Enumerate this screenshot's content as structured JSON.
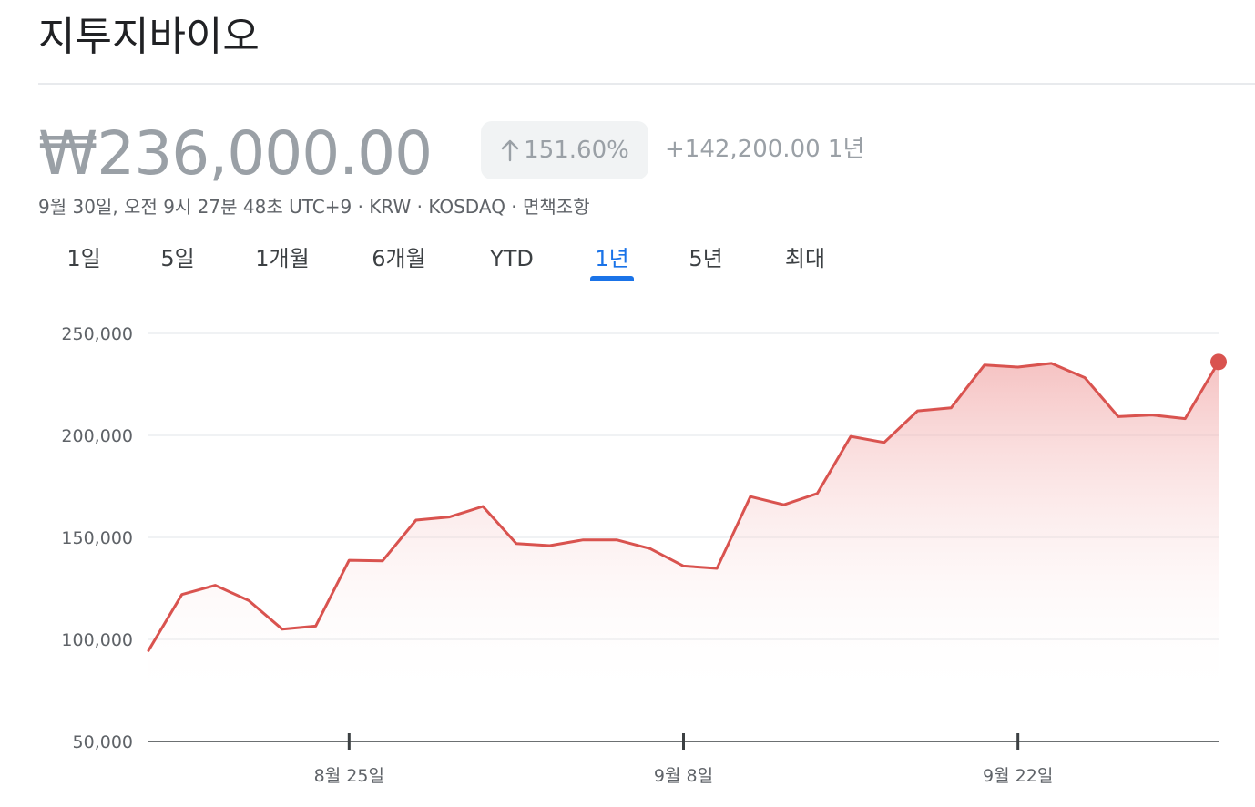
{
  "header": {
    "title": "지투지바이오"
  },
  "quote": {
    "price": "₩236,000.00",
    "change_percent": "151.60%",
    "change_abs": "+142,200.00 1년",
    "meta": "9월 30일, 오전 9시 27분 48초 UTC+9 · KRW · KOSDAQ · 면책조항"
  },
  "tabs": [
    {
      "label": "1일",
      "active": false
    },
    {
      "label": "5일",
      "active": false
    },
    {
      "label": "1개월",
      "active": false
    },
    {
      "label": "6개월",
      "active": false
    },
    {
      "label": "YTD",
      "active": false
    },
    {
      "label": "1년",
      "active": true
    },
    {
      "label": "5년",
      "active": false
    },
    {
      "label": "최대",
      "active": false
    }
  ],
  "colors": {
    "line": "#d9534f",
    "area_top": "#ef9a9a",
    "tab_active": "#1a73e8"
  },
  "chart_data": {
    "type": "area",
    "title": "",
    "xlabel": "",
    "ylabel": "",
    "ylim": [
      50000,
      250000
    ],
    "yticks": [
      250000,
      200000,
      150000,
      100000,
      50000
    ],
    "ytick_labels": [
      "250,000",
      "200,000",
      "150,000",
      "100,000",
      "50,000"
    ],
    "xticks": [
      {
        "index": 6,
        "label": "8월 25일"
      },
      {
        "index": 16,
        "label": "9월 8일"
      },
      {
        "index": 26,
        "label": "9월 22일"
      }
    ],
    "grid": true,
    "series": [
      {
        "values": [
          94500,
          122000,
          126500,
          119000,
          105000,
          106500,
          138800,
          138500,
          158500,
          160000,
          165200,
          147000,
          146000,
          148800,
          148800,
          144500,
          136000,
          134800,
          170000,
          166000,
          171500,
          199500,
          196500,
          212000,
          213500,
          234500,
          233500,
          235300,
          228300,
          209200,
          210000,
          208200,
          236000
        ]
      }
    ]
  }
}
